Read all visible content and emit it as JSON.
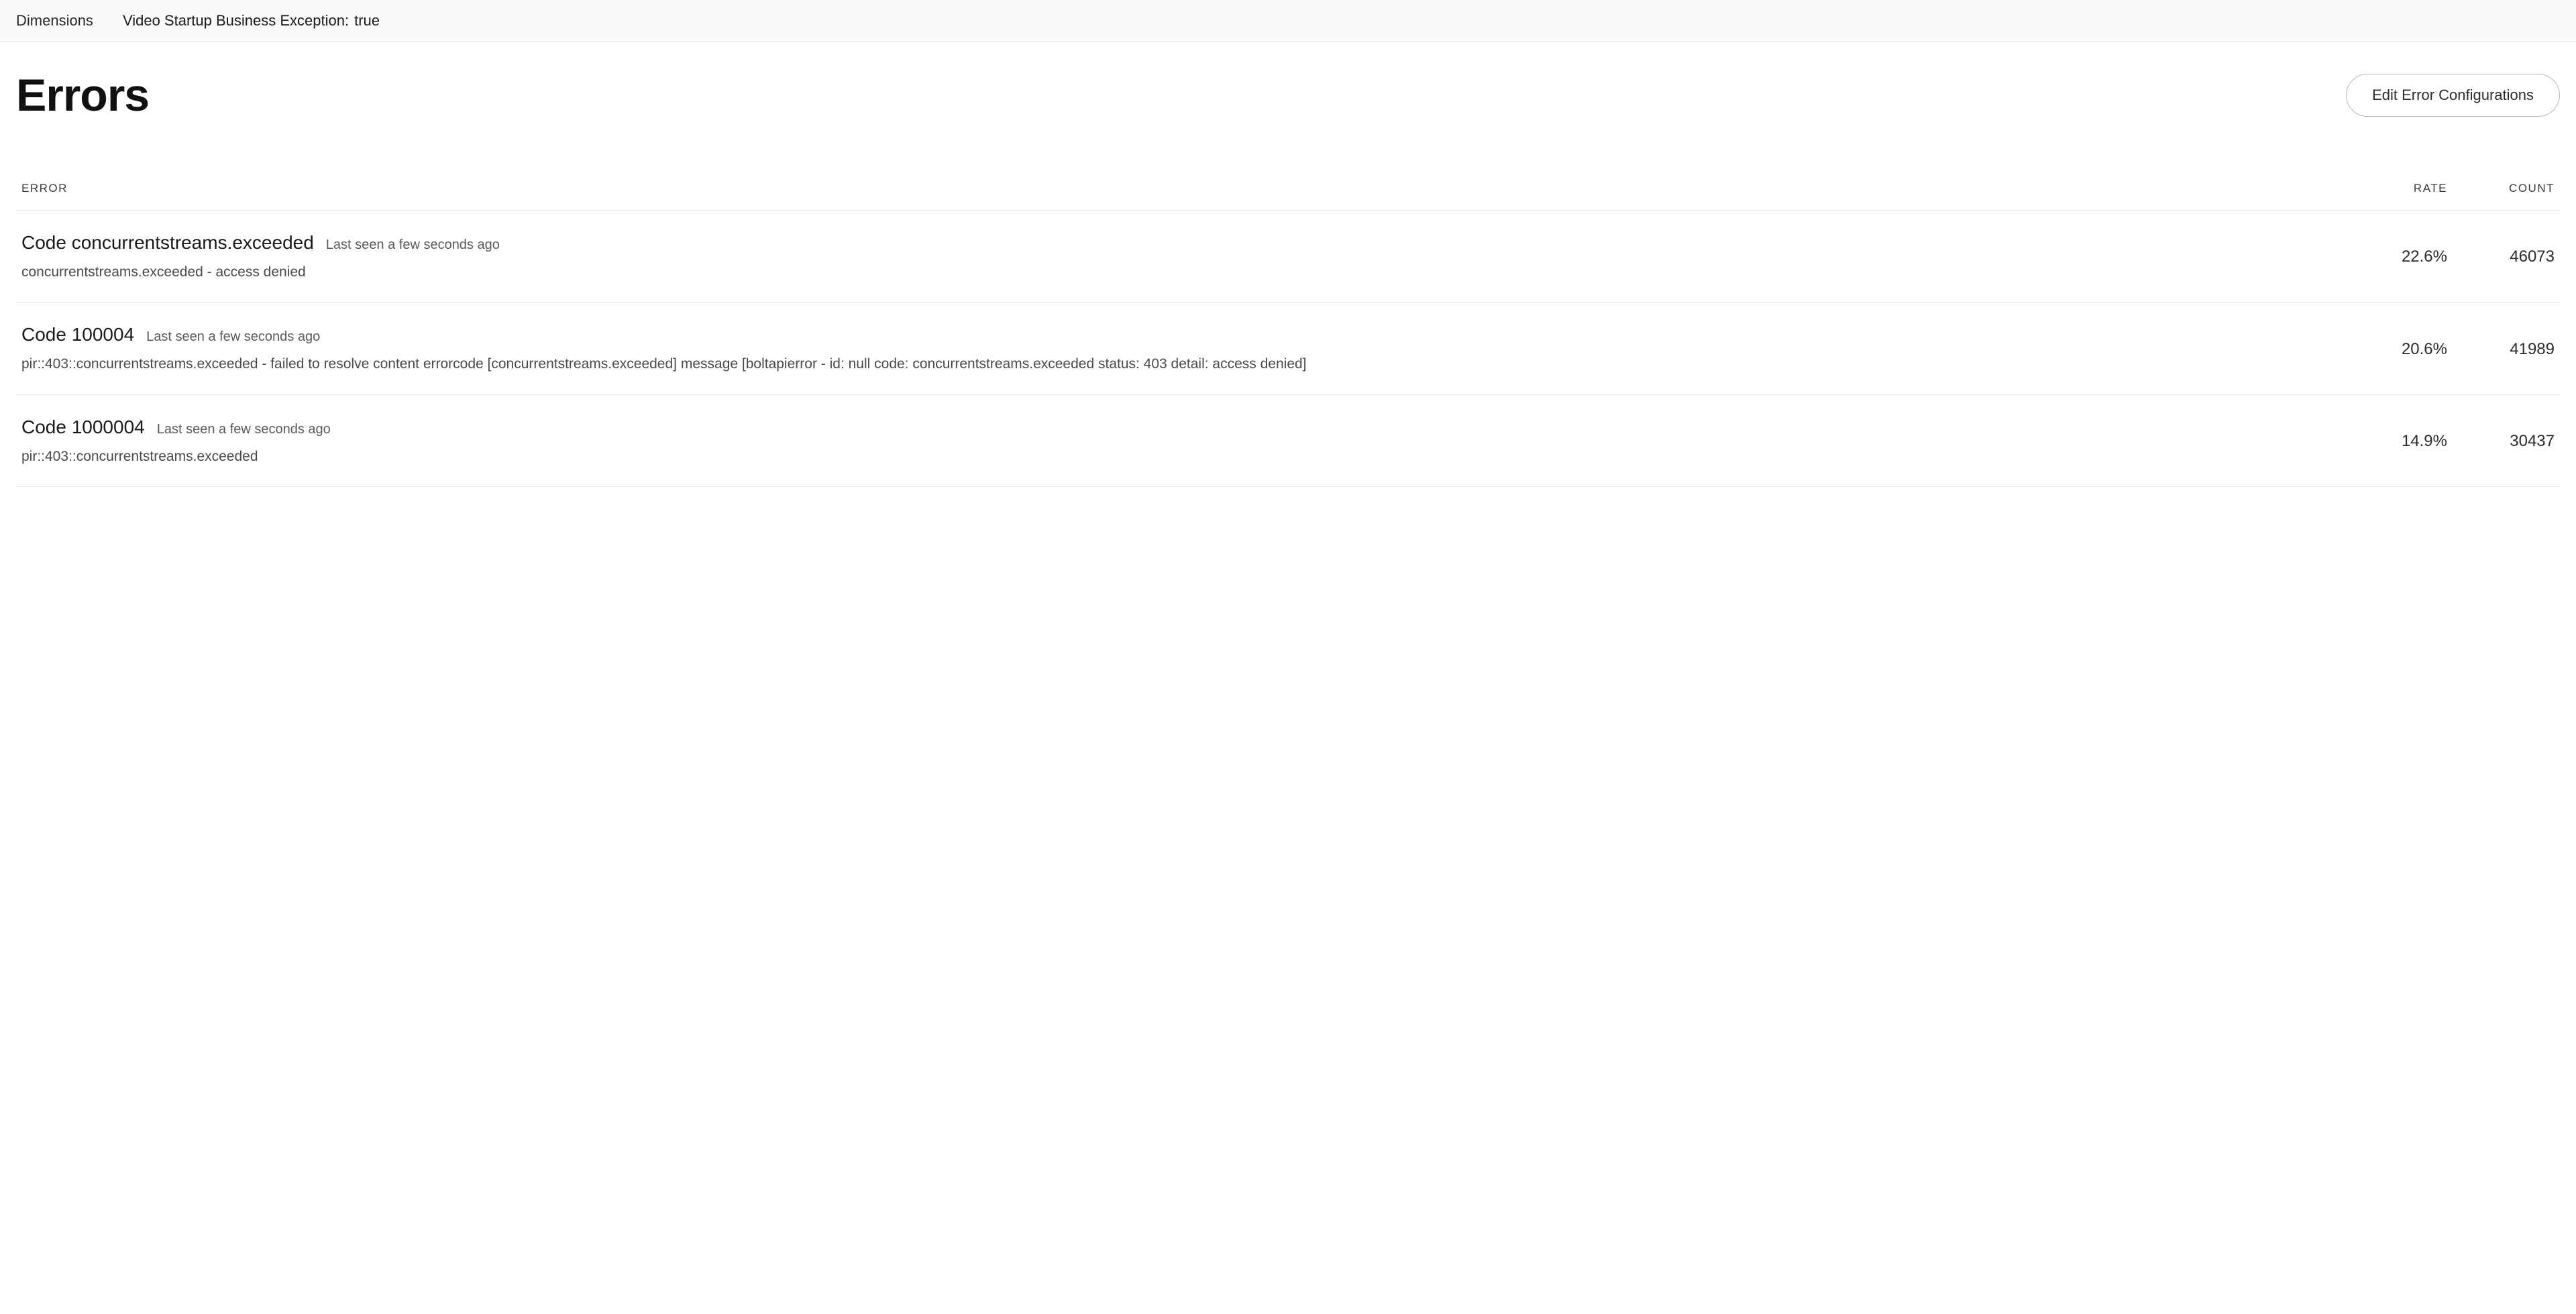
{
  "filter": {
    "dimensions_label": "Dimensions",
    "exception_label": "Video Startup Business Exception:",
    "exception_value": "true"
  },
  "page": {
    "title": "Errors",
    "edit_button": "Edit Error Configurations"
  },
  "table": {
    "headers": {
      "error": "ERROR",
      "rate": "RATE",
      "count": "COUNT"
    },
    "rows": [
      {
        "title": "Code concurrentstreams.exceeded",
        "last_seen": "Last seen a few seconds ago",
        "description": "concurrentstreams.exceeded - access denied",
        "rate": "22.6%",
        "count": "46073"
      },
      {
        "title": "Code 100004",
        "last_seen": "Last seen a few seconds ago",
        "description": "pir::403::concurrentstreams.exceeded - failed to resolve content errorcode [concurrentstreams.exceeded] message [boltapierror - id: null code: concurrentstreams.exceeded status: 403 detail: access denied]",
        "rate": "20.6%",
        "count": "41989"
      },
      {
        "title": "Code 1000004",
        "last_seen": "Last seen a few seconds ago",
        "description": "pir::403::concurrentstreams.exceeded",
        "rate": "14.9%",
        "count": "30437"
      }
    ]
  }
}
